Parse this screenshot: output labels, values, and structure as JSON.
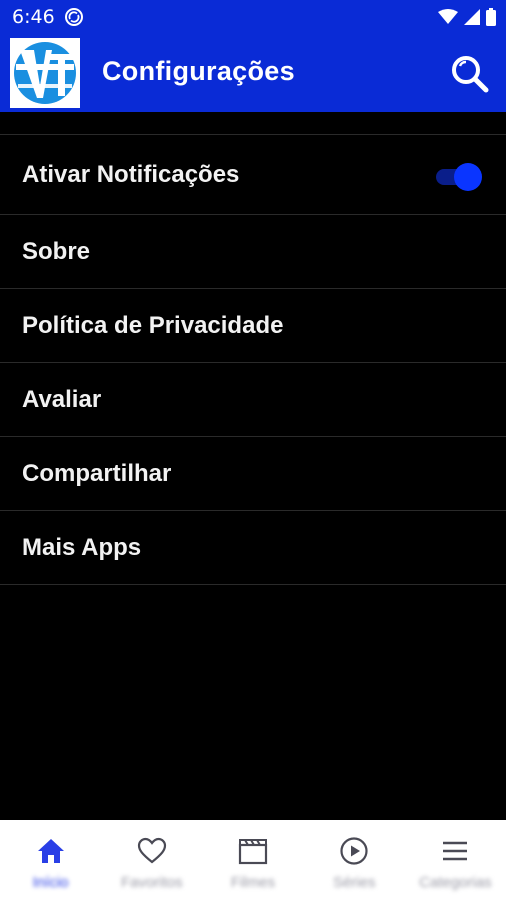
{
  "status_bar": {
    "time": "6:46",
    "icons": [
      "sync-icon",
      "wifi-icon",
      "signal-icon",
      "battery-icon"
    ]
  },
  "app_bar": {
    "logo_text": "VT",
    "title": "Configurações",
    "search_icon": "search-icon",
    "color": "#0a2bd6"
  },
  "settings": {
    "items": [
      {
        "label": "Ativar Notificações",
        "toggle": true,
        "toggle_on": true
      },
      {
        "label": "Sobre"
      },
      {
        "label": "Política de Privacidade"
      },
      {
        "label": "Avaliar"
      },
      {
        "label": "Compartilhar"
      },
      {
        "label": "Mais Apps"
      }
    ]
  },
  "bottom_nav": {
    "items": [
      {
        "label": "Início",
        "icon": "home-icon",
        "active": true
      },
      {
        "label": "Favoritos",
        "icon": "heart-icon",
        "active": false
      },
      {
        "label": "Filmes",
        "icon": "clapperboard-icon",
        "active": false
      },
      {
        "label": "Séries",
        "icon": "play-circle-icon",
        "active": false
      },
      {
        "label": "Categorias",
        "icon": "menu-icon",
        "active": false
      }
    ],
    "active_color": "#2a3fe6",
    "inactive_color": "#4a4a55"
  }
}
